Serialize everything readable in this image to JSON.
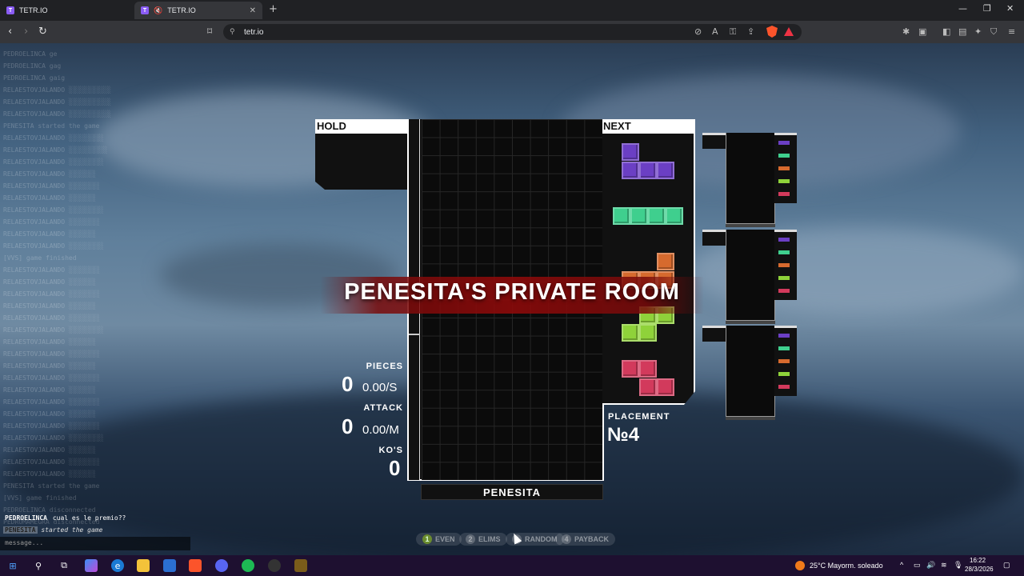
{
  "browser": {
    "tabs": [
      {
        "label": "TETR.IO",
        "favicon": "T"
      },
      {
        "label": "TETR.IO",
        "favicon": "T"
      }
    ],
    "url": "tetr.io"
  },
  "chat": {
    "faded_lines": [
      "PEDROELINCA ge",
      "PEDROELINCA gag",
      "PEDROELINCA gaig",
      "RELAESTOVJALANDO ░░░░░░░░░░░",
      "RELAESTOVJALANDO ░░░░░░░░░░░",
      "RELAESTOVJALANDO ░░░░░░░░░░░",
      "PENESITA started the game",
      "RELAESTOVJALANDO ░░░░░░░░░",
      "RELAESTOVJALANDO ░░░░░░░░░░",
      "RELAESTOVJALANDO ░░░░░░░░░",
      "RELAESTOVJALANDO ░░░░░░░",
      "RELAESTOVJALANDO ░░░░░░░░",
      "RELAESTOVJALANDO ░░░░░░░",
      "RELAESTOVJALANDO ░░░░░░░░░",
      "RELAESTOVJALANDO ░░░░░░░░",
      "RELAESTOVJALANDO ░░░░░░░",
      "RELAESTOVJALANDO ░░░░░░░░░",
      "[VVS] game finished",
      "RELAESTOVJALANDO ░░░░░░░░",
      "RELAESTOVJALANDO ░░░░░░░",
      "RELAESTOVJALANDO ░░░░░░░░",
      "RELAESTOVJALANDO ░░░░░░░",
      "RELAESTOVJALANDO ░░░░░░░░",
      "RELAESTOVJALANDO ░░░░░░░░░",
      "RELAESTOVJALANDO ░░░░░░░",
      "RELAESTOVJALANDO ░░░░░░░░",
      "RELAESTOVJALANDO ░░░░░░░",
      "RELAESTOVJALANDO ░░░░░░░░",
      "RELAESTOVJALANDO ░░░░░░░",
      "RELAESTOVJALANDO ░░░░░░░░",
      "RELAESTOVJALANDO ░░░░░░░",
      "RELAESTOVJALANDO ░░░░░░░░",
      "RELAESTOVJALANDO ░░░░░░░░░",
      "RELAESTOVJALANDO ░░░░░░░",
      "RELAESTOVJALANDO ░░░░░░░░",
      "RELAESTOVJALANDO ░░░░░░░",
      "PENESITA started the game",
      "[VVS] game finished",
      "PEDROELINCA disconnected",
      "PEDROMAMEGRA disconnected"
    ],
    "last_msg_user": "PEDROELINCA",
    "last_msg_text": "cual es le premio??",
    "last_event_user": "PENESITA",
    "last_event_text": "started the game",
    "input_placeholder": "message..."
  },
  "game": {
    "hold_label": "HOLD",
    "next_label": "NEXT",
    "room_title": "PENESITA'S PRIVATE ROOM",
    "player_name": "PENESITA",
    "pieces_label": "PIECES",
    "pieces_value": "0",
    "pieces_rate": "0.00/S",
    "attack_label": "ATTACK",
    "attack_value": "0",
    "attack_rate": "0.00/M",
    "kos_label": "KO'S",
    "kos_value": "0",
    "placement_label": "PLACEMENT",
    "placement_value": "№4",
    "next_queue": [
      "J-purple",
      "I-green",
      "L-orange",
      "S-lime",
      "Z-red"
    ],
    "colors": {
      "purple": "#6b3fc4",
      "green": "#3fcf8e",
      "orange": "#d66a2e",
      "lime": "#8fd23a",
      "red": "#d23a5c"
    }
  },
  "keybinds": [
    {
      "num": "1",
      "label": "EVEN"
    },
    {
      "num": "2",
      "label": "ELIMS"
    },
    {
      "num": "3",
      "label": "RANDOM"
    },
    {
      "num": "4",
      "label": "PAYBACK"
    }
  ],
  "taskbar": {
    "weather": "25°C  Mayorm. soleado",
    "time": "16:22",
    "date": "28/3/2026"
  }
}
